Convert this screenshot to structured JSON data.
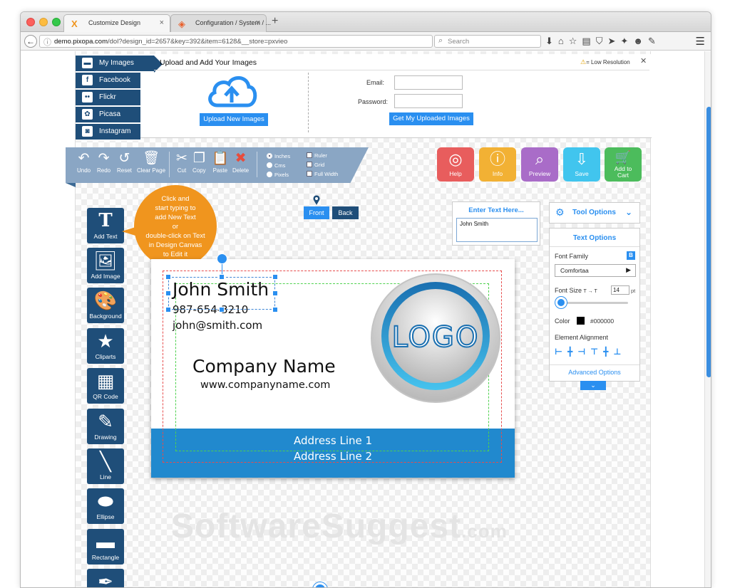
{
  "browser": {
    "tabs": [
      {
        "title": "Customize Design"
      },
      {
        "title": "Configuration / System / ..."
      }
    ],
    "url_domain": "demo.pixopa.com",
    "url_path": "/dol?design_id=2657&key=392&item=6128&__store=pxvieo",
    "search_placeholder": "Search"
  },
  "upload": {
    "title": "Upload and Add Your Images",
    "low_res_label": "= Low Resolution",
    "sources": [
      {
        "label": "My Images",
        "icon": "folder-icon"
      },
      {
        "label": "Facebook",
        "icon": "facebook-icon"
      },
      {
        "label": "Flickr",
        "icon": "flickr-icon"
      },
      {
        "label": "Picasa",
        "icon": "picasa-icon"
      },
      {
        "label": "Instagram",
        "icon": "instagram-icon"
      }
    ],
    "upload_button": "Upload New Images",
    "email_label": "Email:",
    "password_label": "Password:",
    "get_images_button": "Get My Uploaded Images"
  },
  "toolbar": {
    "undo": "Undo",
    "redo": "Redo",
    "reset": "Reset",
    "clear": "Clear Page",
    "cut": "Cut",
    "copy": "Copy",
    "paste": "Paste",
    "delete": "Delete",
    "units": [
      "Inches",
      "Cms",
      "Pixels"
    ],
    "selected_unit": "Inches",
    "view_options": [
      "Ruler",
      "Grid",
      "Full Width"
    ]
  },
  "actions": [
    {
      "label": "Help",
      "color": "#e85d5d",
      "icon": "lifebuoy-icon"
    },
    {
      "label": "Info",
      "color": "#f2b134",
      "icon": "info-icon"
    },
    {
      "label": "Preview",
      "color": "#a96cc8",
      "icon": "preview-icon"
    },
    {
      "label": "Save",
      "color": "#41c5ee",
      "icon": "download-icon"
    },
    {
      "label": "Add to Cart",
      "color": "#4cbc5c",
      "icon": "cart-icon"
    }
  ],
  "tools": [
    {
      "label": "Add Text"
    },
    {
      "label": "Add Image"
    },
    {
      "label": "Background"
    },
    {
      "label": "Cliparts"
    },
    {
      "label": "QR Code"
    },
    {
      "label": "Drawing"
    },
    {
      "label": "Line"
    },
    {
      "label": "Ellipse"
    },
    {
      "label": "Rectangle"
    }
  ],
  "callout": {
    "line1": "Click and",
    "line2": "start typing to",
    "line3": "add New Text",
    "line4": "or",
    "line5": "double-click on Text",
    "line6": "in Design Canvas",
    "line7": "to Edit it"
  },
  "sides": {
    "front": "Front",
    "back": "Back"
  },
  "text_entry": {
    "title": "Enter Text Here...",
    "value": "John Smith"
  },
  "tool_options": {
    "title": "Tool Options",
    "text_options_title": "Text Options",
    "font_family_label": "Font Family",
    "bold_label": "B",
    "font": "Comfortaa",
    "font_size_label": "Font Size",
    "font_size_value": "14",
    "font_size_unit": "pt",
    "color_label": "Color",
    "color_value": "#000000",
    "alignment_label": "Element Alignment",
    "advanced": "Advanced Options"
  },
  "card": {
    "name": "John Smith",
    "phone": "987-654-3210",
    "email": "john@smith.com",
    "company": "Company Name",
    "website": "www.companyname.com",
    "address1": "Address Line 1",
    "address2": "Address Line 2",
    "logo_text": "LOGO",
    "band_color": "#2189ce"
  },
  "watermark": {
    "main": "SoftwareSuggest",
    "suffix": ".com"
  }
}
